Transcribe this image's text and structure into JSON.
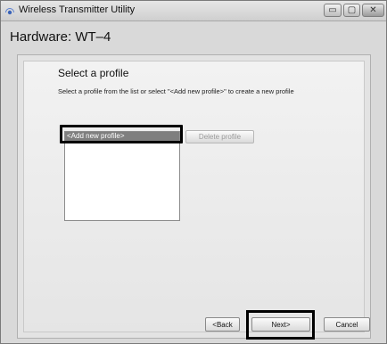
{
  "window": {
    "title": "Wireless Transmitter Utility",
    "controls": {
      "minimize": "▭",
      "maximize": "▢",
      "close": "✕"
    }
  },
  "header": {
    "hardware_label": "Hardware: WT–4"
  },
  "main": {
    "heading": "Select a profile",
    "description": "Select a profile from the list or select \"<Add new profile>\" to create a new profile",
    "profiles": [
      "<Add new profile>"
    ],
    "delete_button": "Delete profile"
  },
  "footer": {
    "back_button": "<Back",
    "next_button": "Next>",
    "cancel_button": "Cancel"
  },
  "icons": {
    "app": "wireless-icon"
  }
}
